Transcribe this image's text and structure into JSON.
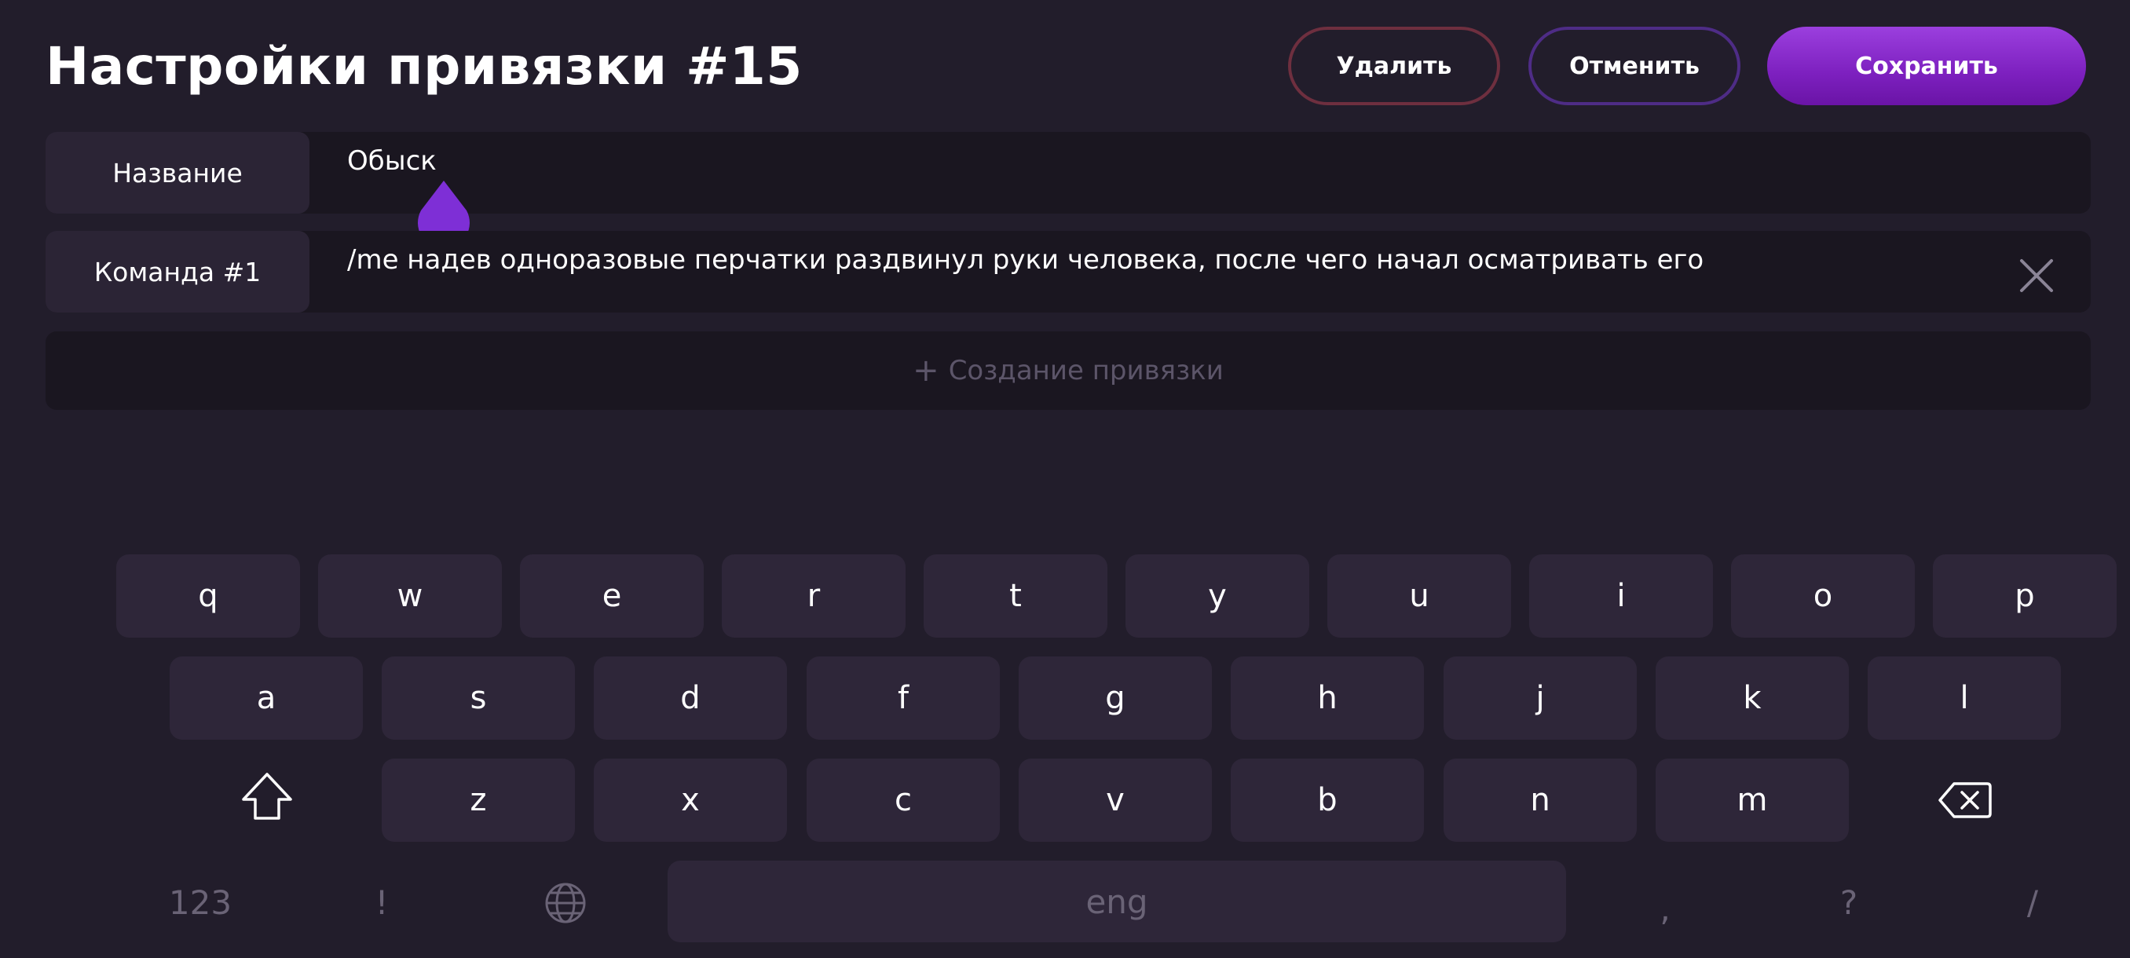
{
  "header": {
    "title": "Настройки привязки #15",
    "delete_label": "Удалить",
    "cancel_label": "Отменить",
    "save_label": "Сохранить"
  },
  "form": {
    "name_label": "Название",
    "name_value": "Обыск",
    "command_label": "Команда #1",
    "command_value": "/me надев одноразовые перчатки раздвинул руки человека, после чего начал осматривать его",
    "add_label": "Создание привязки"
  },
  "keyboard": {
    "row1": [
      "q",
      "w",
      "e",
      "r",
      "t",
      "y",
      "u",
      "i",
      "o",
      "p"
    ],
    "row2": [
      "a",
      "s",
      "d",
      "f",
      "g",
      "h",
      "j",
      "k",
      "l"
    ],
    "row3": [
      "z",
      "x",
      "c",
      "v",
      "b",
      "n",
      "m"
    ],
    "numbers_label": "123",
    "exclaim_label": "!",
    "space_label": "eng",
    "comma_label": ",",
    "question_label": "?",
    "slash_label": "/",
    "icons": {
      "shift": "shift-icon",
      "backspace": "backspace-icon",
      "language": "globe-icon",
      "clear": "close-icon"
    }
  },
  "colors": {
    "background": "#221d2b",
    "accent": "#7e2fd6",
    "delete_border": "#6e2f3f",
    "cancel_border": "#4e2c86"
  }
}
